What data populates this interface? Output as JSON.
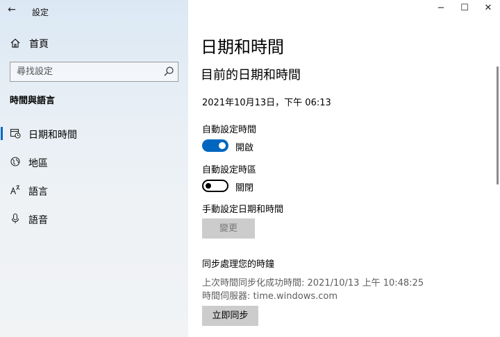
{
  "window": {
    "app_title": "設定",
    "back_glyph": "←",
    "minimize_glyph": "−",
    "maximize_glyph": "☐",
    "close_glyph": "✕"
  },
  "sidebar": {
    "home_label": "首頁",
    "search_placeholder": "尋找設定",
    "section_heading": "時間與語言",
    "items": [
      {
        "label": "日期和時間",
        "icon": "calendar-clock-icon",
        "selected": true
      },
      {
        "label": "地區",
        "icon": "globe-icon",
        "selected": false
      },
      {
        "label": "語言",
        "icon": "language-icon",
        "selected": false
      },
      {
        "label": "語音",
        "icon": "microphone-icon",
        "selected": false
      }
    ]
  },
  "main": {
    "page_title": "日期和時間",
    "subtitle": "目前的日期和時間",
    "current_datetime": "2021年10月13日，下午 06:13",
    "auto_time": {
      "label": "自動設定時間",
      "state_text": "開啟",
      "on": true
    },
    "auto_timezone": {
      "label": "自動設定時區",
      "state_text": "關閉",
      "on": false
    },
    "manual": {
      "label": "手動設定日期和時間",
      "button": "變更"
    },
    "sync": {
      "heading": "同步處理您的時鐘",
      "last_sync": "上次時間同步化成功時間: 2021/10/13 上午 10:48:25",
      "server": "時間伺服器: time.windows.com",
      "button": "立即同步"
    }
  },
  "colors": {
    "accent": "#0067c0",
    "button_gray": "#cccccc",
    "muted_text": "#5d5d5d"
  }
}
